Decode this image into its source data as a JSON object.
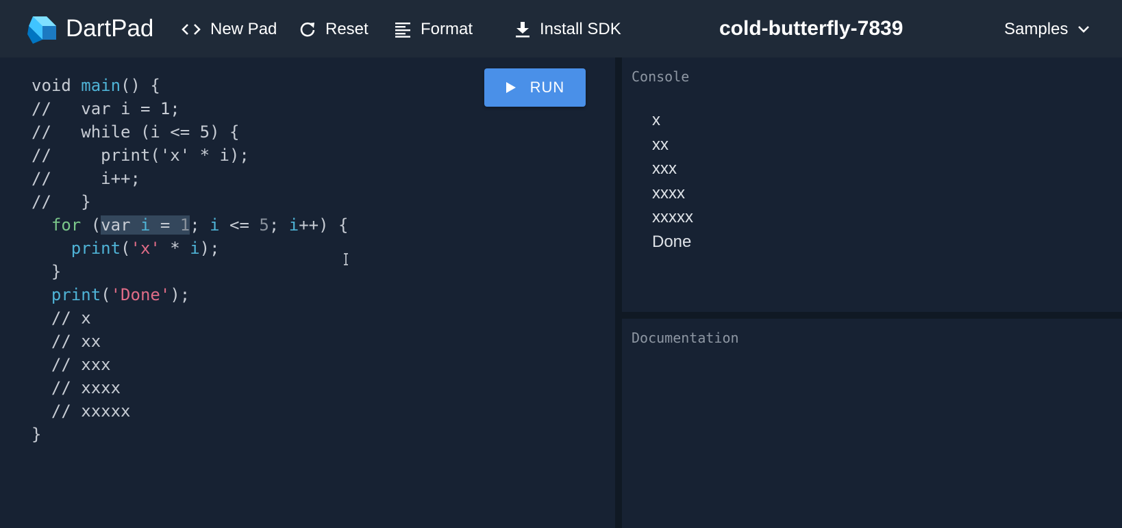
{
  "app": {
    "name": "DartPad",
    "pad_title": "cold-butterfly-7839"
  },
  "toolbar": {
    "new_pad": "New Pad",
    "reset": "Reset",
    "format": "Format",
    "install_sdk": "Install SDK",
    "samples": "Samples"
  },
  "editor": {
    "run_label": "RUN",
    "code_lines": [
      [
        {
          "t": "void "
        },
        {
          "t": "main",
          "c": "fn"
        },
        {
          "t": "() {"
        }
      ],
      [
        {
          "t": "//   var i = 1;"
        }
      ],
      [
        {
          "t": "//   while (i <= 5) {"
        }
      ],
      [
        {
          "t": "//     print('x' * i);"
        }
      ],
      [
        {
          "t": "//     i++;"
        }
      ],
      [
        {
          "t": "//   }"
        }
      ],
      [
        {
          "t": "  "
        },
        {
          "t": "for",
          "c": "kw"
        },
        {
          "t": " ("
        },
        {
          "t": "var ",
          "c": "sel"
        },
        {
          "t": "i",
          "c": "var sel"
        },
        {
          "t": " = ",
          "c": "sel"
        },
        {
          "t": "1",
          "c": "num sel"
        },
        {
          "t": "; "
        },
        {
          "t": "i",
          "c": "var"
        },
        {
          "t": " <= "
        },
        {
          "t": "5",
          "c": "num"
        },
        {
          "t": "; "
        },
        {
          "t": "i",
          "c": "var"
        },
        {
          "t": "++) {"
        }
      ],
      [
        {
          "t": "    "
        },
        {
          "t": "print",
          "c": "fn"
        },
        {
          "t": "("
        },
        {
          "t": "'x'",
          "c": "str"
        },
        {
          "t": " * "
        },
        {
          "t": "i",
          "c": "var"
        },
        {
          "t": ");"
        }
      ],
      [
        {
          "t": "  }"
        }
      ],
      [
        {
          "t": "  "
        },
        {
          "t": "print",
          "c": "fn"
        },
        {
          "t": "("
        },
        {
          "t": "'Done'",
          "c": "str"
        },
        {
          "t": ");"
        }
      ],
      [
        {
          "t": "  // x"
        }
      ],
      [
        {
          "t": "  // xx"
        }
      ],
      [
        {
          "t": "  // xxx"
        }
      ],
      [
        {
          "t": "  // xxxx"
        }
      ],
      [
        {
          "t": "  // xxxxx"
        }
      ],
      [
        {
          "t": "}"
        }
      ]
    ]
  },
  "console": {
    "label": "Console",
    "output": [
      "x",
      "xx",
      "xxx",
      "xxxx",
      "xxxxx",
      "Done"
    ]
  },
  "docs": {
    "label": "Documentation"
  },
  "icons": {
    "logo": "dart-logo-icon",
    "new_pad": "code-brackets-icon",
    "reset": "refresh-icon",
    "format": "format-lines-icon",
    "install_sdk": "download-icon",
    "samples": "chevron-down-icon",
    "run": "play-icon"
  },
  "colors": {
    "accent": "#4a90e8",
    "topbar": "#1f2a38",
    "background": "#172233"
  }
}
